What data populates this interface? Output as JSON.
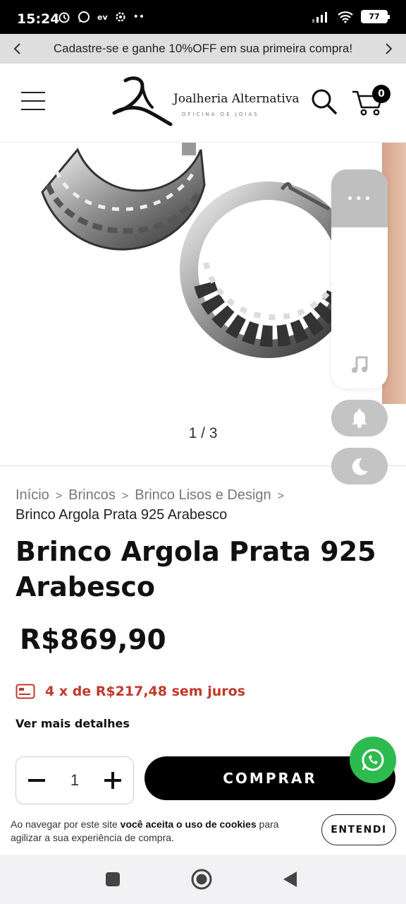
{
  "status_bar": {
    "time": "15:24",
    "left_icons": [
      "alarm-icon",
      "whatsapp-icon",
      "ev-icon",
      "settings-icon",
      "more-icon"
    ],
    "ev_label": "ev",
    "battery": "77"
  },
  "promo": {
    "text": "Cadastre-se e ganhe 10%OFF em sua primeira compra!"
  },
  "header": {
    "logo_name": "Joalheria Alternativa",
    "logo_subtitle": "OFICINA DE JOIAS",
    "cart_count": "0"
  },
  "gallery": {
    "counter": "1 / 3"
  },
  "breadcrumb": {
    "items": [
      "Início",
      "Brincos",
      "Brinco Lisos e Design"
    ],
    "separator": ">",
    "current": "Brinco Argola Prata 925 Arabesco"
  },
  "product": {
    "title": "Brinco Argola Prata 925 Arabesco",
    "price": "R$869,90",
    "installments": "4 x de R$217,48 sem juros",
    "more_details": "Ver mais detalhes",
    "quantity": "1",
    "buy_label": "COMPRAR"
  },
  "cookie": {
    "text_before": "Ao navegar por este site ",
    "text_bold": "você aceita o uso de cookies",
    "text_after": " para agilizar a sua experiência de compra.",
    "button": "ENTENDI"
  },
  "colors": {
    "accent": "#000000",
    "installment": "#c0392b",
    "whatsapp": "#2dbb4f",
    "promo_bg": "#dedede"
  }
}
